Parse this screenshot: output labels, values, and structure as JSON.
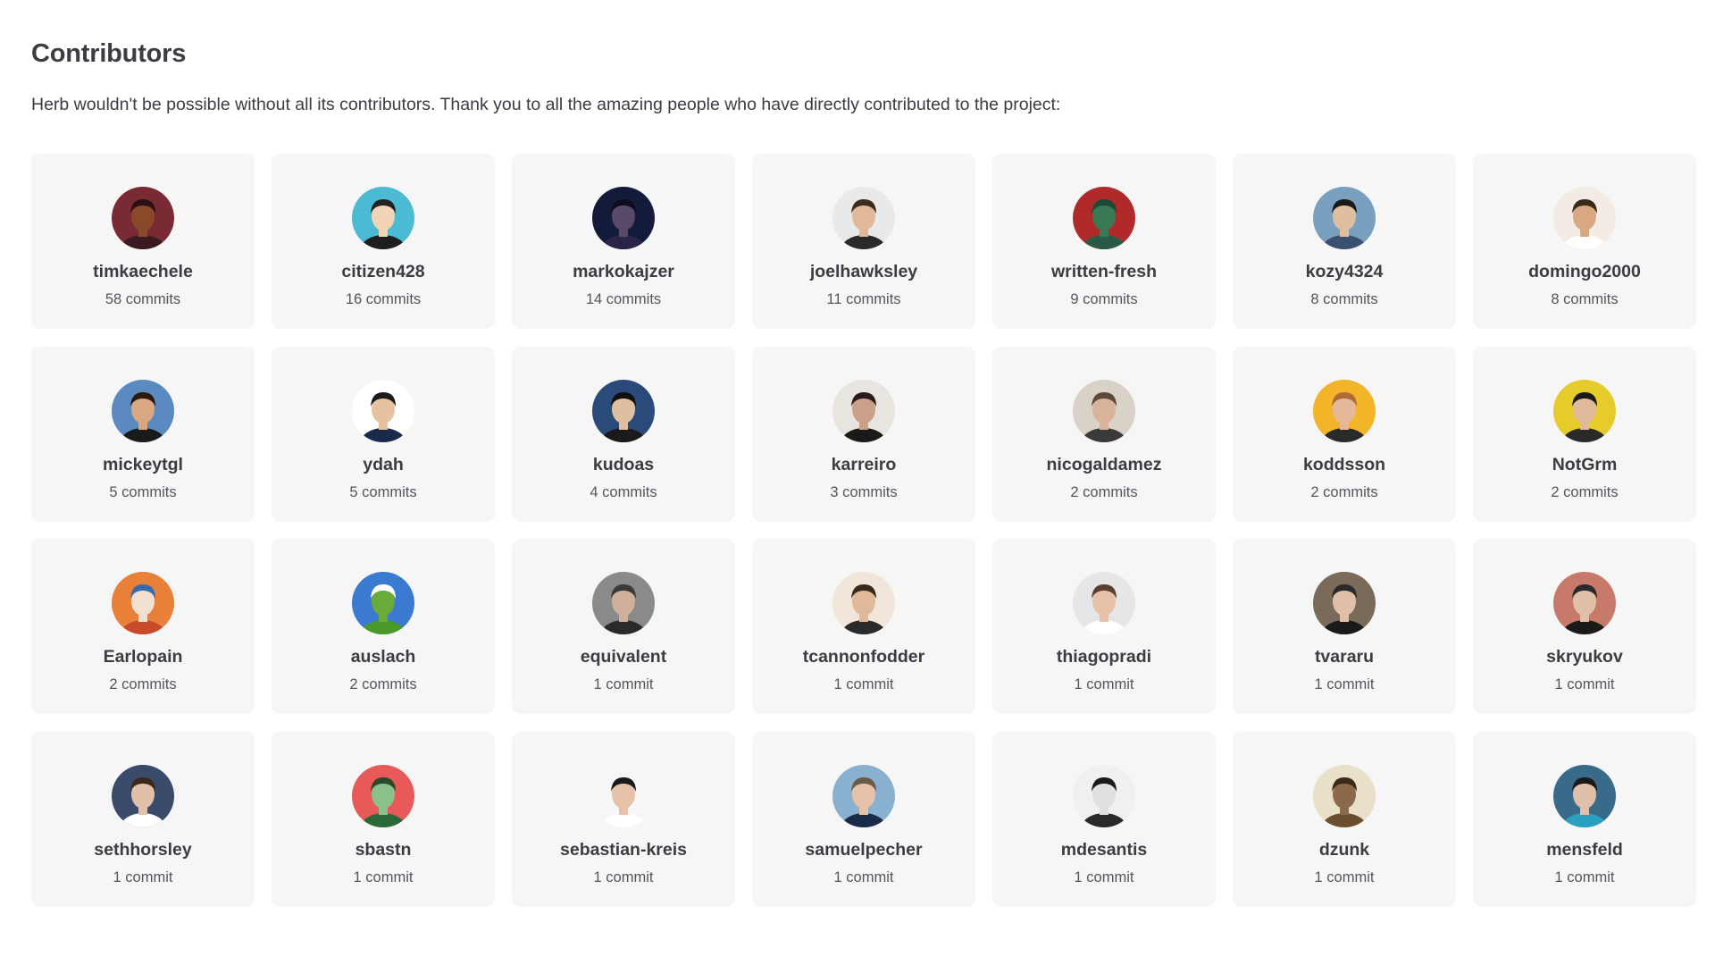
{
  "page": {
    "title": "Contributors",
    "intro": "Herb wouldn't be possible without all its contributors. Thank you to all the amazing people who have directly contributed to the project:"
  },
  "contributors": [
    {
      "name": "timkaechele",
      "commits": "58 commits",
      "avatar": {
        "bg": "#7a2a35",
        "skin": "#8a4a2a",
        "hair": "#2a1010",
        "shirt": "#3a1a20"
      }
    },
    {
      "name": "citizen428",
      "commits": "16 commits",
      "avatar": {
        "bg": "#4bbbd4",
        "skin": "#f2d3b5",
        "hair": "#222222",
        "shirt": "#1e1e1e"
      }
    },
    {
      "name": "markokajzer",
      "commits": "14 commits",
      "avatar": {
        "bg": "#141a3a",
        "skin": "#5a4a6a",
        "hair": "#0d0d1e",
        "shirt": "#2a2448"
      }
    },
    {
      "name": "joelhawksley",
      "commits": "11 commits",
      "avatar": {
        "bg": "#e9e9e9",
        "skin": "#e0b89a",
        "hair": "#3a2a20",
        "shirt": "#2a2a2a"
      }
    },
    {
      "name": "written-fresh",
      "commits": "9 commits",
      "avatar": {
        "bg": "#b02a2a",
        "skin": "#3a7a55",
        "hair": "#1e4a35",
        "shirt": "#2a5a45"
      }
    },
    {
      "name": "kozy4324",
      "commits": "8 commits",
      "avatar": {
        "bg": "#7aa0c0",
        "skin": "#e0bfa0",
        "hair": "#1a1a1a",
        "shirt": "#3a5070"
      }
    },
    {
      "name": "domingo2000",
      "commits": "8 commits",
      "avatar": {
        "bg": "#f3ece4",
        "skin": "#d9a882",
        "hair": "#3a2a1a",
        "shirt": "#ffffff"
      }
    },
    {
      "name": "mickeytgl",
      "commits": "5 commits",
      "avatar": {
        "bg": "#5a8ac0",
        "skin": "#d9a882",
        "hair": "#2a1a10",
        "shirt": "#1a1a1a"
      }
    },
    {
      "name": "ydah",
      "commits": "5 commits",
      "avatar": {
        "bg": "#ffffff",
        "skin": "#e6c2a0",
        "hair": "#1a1a1a",
        "shirt": "#1a2a4a"
      }
    },
    {
      "name": "kudoas",
      "commits": "4 commits",
      "avatar": {
        "bg": "#2a4a7a",
        "skin": "#e0bfa0",
        "hair": "#101010",
        "shirt": "#1a1a1a"
      }
    },
    {
      "name": "karreiro",
      "commits": "3 commits",
      "avatar": {
        "bg": "#e8e4e0",
        "skin": "#c9a08a",
        "hair": "#2a1a1a",
        "shirt": "#1a1a1a"
      }
    },
    {
      "name": "nicogaldamez",
      "commits": "2 commits",
      "avatar": {
        "bg": "#d9d2c8",
        "skin": "#d9b49a",
        "hair": "#5a4a3a",
        "shirt": "#3a3a3a"
      }
    },
    {
      "name": "koddsson",
      "commits": "2 commits",
      "avatar": {
        "bg": "#f2b52a",
        "skin": "#e6b89a",
        "hair": "#b06a3a",
        "shirt": "#2a2a2a"
      }
    },
    {
      "name": "NotGrm",
      "commits": "2 commits",
      "avatar": {
        "bg": "#e6cc2a",
        "skin": "#e0b89a",
        "hair": "#1a1a1a",
        "shirt": "#2a2a2a"
      }
    },
    {
      "name": "Earlopain",
      "commits": "2 commits",
      "avatar": {
        "bg": "#e8803a",
        "skin": "#f2e0d0",
        "hair": "#3a6aaa",
        "shirt": "#c84a2a"
      }
    },
    {
      "name": "auslach",
      "commits": "2 commits",
      "avatar": {
        "bg": "#3a7ad0",
        "skin": "#6aaa3a",
        "hair": "#ffffff",
        "shirt": "#4a9a2a"
      }
    },
    {
      "name": "equivalent",
      "commits": "1 commit",
      "avatar": {
        "bg": "#8a8a8a",
        "skin": "#d0b09a",
        "hair": "#3a3a3a",
        "shirt": "#2a2a2a"
      }
    },
    {
      "name": "tcannonfodder",
      "commits": "1 commit",
      "avatar": {
        "bg": "#f0e6da",
        "skin": "#e0b89a",
        "hair": "#3a2a1a",
        "shirt": "#2a2a2a"
      }
    },
    {
      "name": "thiagopradi",
      "commits": "1 commit",
      "avatar": {
        "bg": "#e6e6e6",
        "skin": "#e6c2a8",
        "hair": "#5a4030",
        "shirt": "#ffffff"
      }
    },
    {
      "name": "tvararu",
      "commits": "1 commit",
      "avatar": {
        "bg": "#7a6a5a",
        "skin": "#e0c0a8",
        "hair": "#2a2a2a",
        "shirt": "#1a1a1a"
      }
    },
    {
      "name": "skryukov",
      "commits": "1 commit",
      "avatar": {
        "bg": "#c87a6a",
        "skin": "#e0c0a8",
        "hair": "#2a2a2a",
        "shirt": "#1a1a1a"
      }
    },
    {
      "name": "sethhorsley",
      "commits": "1 commit",
      "avatar": {
        "bg": "#3a4a6a",
        "skin": "#e0c0a8",
        "hair": "#3a2a1a",
        "shirt": "#ffffff"
      }
    },
    {
      "name": "sbastn",
      "commits": "1 commit",
      "avatar": {
        "bg": "#e85a5a",
        "skin": "#8ac08a",
        "hair": "#2a4a2a",
        "shirt": "#2a6a3a"
      }
    },
    {
      "name": "sebastian-kreis",
      "commits": "1 commit",
      "avatar": {
        "bg": "#f6f6f6",
        "skin": "#e6c2a8",
        "hair": "#1a1a1a",
        "shirt": "#ffffff"
      }
    },
    {
      "name": "samuelpecher",
      "commits": "1 commit",
      "avatar": {
        "bg": "#8ab0d0",
        "skin": "#e6c2a8",
        "hair": "#6a5a4a",
        "shirt": "#1a2a4a"
      }
    },
    {
      "name": "mdesantis",
      "commits": "1 commit",
      "avatar": {
        "bg": "#f0f0f0",
        "skin": "#e0e0e0",
        "hair": "#1a1a1a",
        "shirt": "#2a2a2a"
      }
    },
    {
      "name": "dzunk",
      "commits": "1 commit",
      "avatar": {
        "bg": "#e8e0c8",
        "skin": "#8a6a4a",
        "hair": "#3a2a1a",
        "shirt": "#6a5030"
      }
    },
    {
      "name": "mensfeld",
      "commits": "1 commit",
      "avatar": {
        "bg": "#3a6a8a",
        "skin": "#e0c0a8",
        "hair": "#1a1a1a",
        "shirt": "#2aa0c0"
      }
    }
  ]
}
